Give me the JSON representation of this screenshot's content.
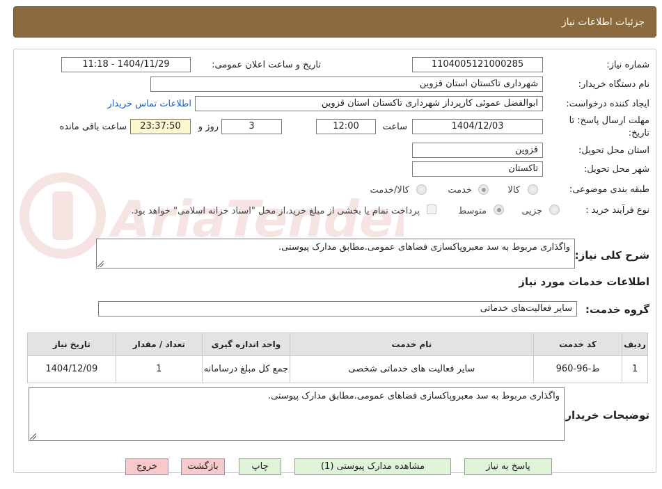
{
  "header": {
    "title": "جزئیات اطلاعات نیاز"
  },
  "fields": {
    "need_number": {
      "label": "شماره نیاز:",
      "value": "1104005121000285"
    },
    "announce_datetime": {
      "label": "تاریخ و ساعت اعلان عمومی:",
      "value": "1404/11/29 - 11:18"
    },
    "buyer_org": {
      "label": "نام دستگاه خریدار:",
      "value": "شهرداری تاکستان استان قزوین"
    },
    "requester": {
      "label": "ایجاد کننده درخواست:",
      "value": "ابوالفضل عموئی کارپرداز شهرداری تاکستان استان قزوین"
    },
    "contact_link": "اطلاعات تماس خریدار",
    "deadline": {
      "label_line1": "مهلت ارسال پاسخ: تا",
      "label_line2": "تاریخ:",
      "date": "1404/12/03",
      "time_label": "ساعت",
      "time": "12:00",
      "days": "3",
      "days_label": "روز و",
      "remaining": "23:37:50",
      "remaining_label": "ساعت باقی مانده"
    },
    "delivery_province": {
      "label": "استان محل تحویل:",
      "value": "قزوین"
    },
    "delivery_city": {
      "label": "شهر محل تحویل:",
      "value": "تاکستان"
    },
    "category": {
      "label": "طبقه بندی موضوعی:",
      "options": [
        "کالا",
        "خدمت",
        "کالا/خدمت"
      ],
      "selected": "خدمت"
    },
    "purchase_type": {
      "label": "نوع فرآیند خرید :",
      "options": [
        "جزیی",
        "متوسط"
      ],
      "selected": "متوسط",
      "payment_note": "پرداخت تمام یا بخشی از مبلغ خرید،از محل \"اسناد خزانه اسلامی\" خواهد بود."
    }
  },
  "general_description": {
    "label": "شرح کلی نیاز:",
    "value": "واگذاری مربوط به سد معبروپاکسازی فضاهای عمومی.مطابق مدارک پیوستی."
  },
  "services_section": {
    "title": "اطلاعات خدمات مورد نیاز",
    "group_label": "گروه خدمت:",
    "group_value": "سایر فعالیت‌های خدماتی"
  },
  "table": {
    "headers": [
      "ردیف",
      "کد خدمت",
      "نام خدمت",
      "واحد اندازه گیری",
      "تعداد / مقدار",
      "تاریخ نیاز"
    ],
    "rows": [
      [
        "1",
        "ط-96-960",
        "سایر فعالیت های خدماتی شخصی",
        "جمع کل مبلغ درسامانه",
        "1",
        "1404/12/09"
      ]
    ]
  },
  "buyer_notes": {
    "label": "توضیحات خریدار:",
    "value": "واگذاری مربوط به سد معبروپاکسازی فضاهای عمومی.مطابق مدارک پیوستی."
  },
  "buttons": {
    "respond": "پاسخ به نیاز",
    "view_docs": "مشاهده مدارک پیوستی (1)",
    "print": "چاپ",
    "back": "بازگشت",
    "exit": "خروج"
  },
  "watermark": {
    "text": "AriaTender.neT",
    "color": "#c0392b"
  },
  "colors": {
    "header": "#8b6a3e",
    "link": "#1a5ec7",
    "green_button": "#dff3d8",
    "pink_button": "#f7c9cd"
  }
}
